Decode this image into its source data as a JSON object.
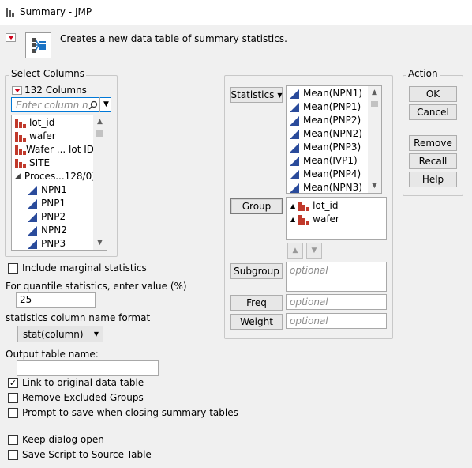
{
  "window": {
    "title": "Summary - JMP"
  },
  "header": {
    "description": "Creates a new data table of summary statistics."
  },
  "select_columns": {
    "legend": "Select Columns",
    "count_label": "132 Columns",
    "search_placeholder": "Enter column n",
    "items": [
      "lot_id",
      "wafer",
      "Wafer ... lot ID",
      "SITE",
      "Proces...128/0)",
      "NPN1",
      "PNP1",
      "PNP2",
      "NPN2",
      "PNP3"
    ]
  },
  "role_buttons": {
    "statistics": "Statistics",
    "group": "Group",
    "subgroup": "Subgroup",
    "freq": "Freq",
    "weight": "Weight"
  },
  "statistics_list": [
    "Mean(NPN1)",
    "Mean(PNP1)",
    "Mean(PNP2)",
    "Mean(NPN2)",
    "Mean(PNP3)",
    "Mean(IVP1)",
    "Mean(PNP4)",
    "Mean(NPN3)"
  ],
  "group_list": [
    "lot_id",
    "wafer"
  ],
  "placeholders": {
    "optional": "optional"
  },
  "action": {
    "legend": "Action",
    "ok": "OK",
    "cancel": "Cancel",
    "remove": "Remove",
    "recall": "Recall",
    "help": "Help"
  },
  "options": {
    "marginal": "Include marginal statistics",
    "quantile_label": "For quantile statistics, enter value (%)",
    "quantile_value": "25",
    "name_format_label": "statistics column name format",
    "name_format_value": "stat(column)",
    "output_label": "Output table name:",
    "output_value": "",
    "link": "Link to original data table",
    "link_checked": "✓",
    "remove_excluded": "Remove Excluded Groups",
    "prompt_save": "Prompt to save when closing summary tables",
    "keep_open": "Keep dialog open",
    "save_script": "Save Script to Source Table"
  },
  "colors": {
    "accent_red": "#d0021b",
    "nominal_blue": "#2a4b9b",
    "focus_border": "#0078d7"
  }
}
